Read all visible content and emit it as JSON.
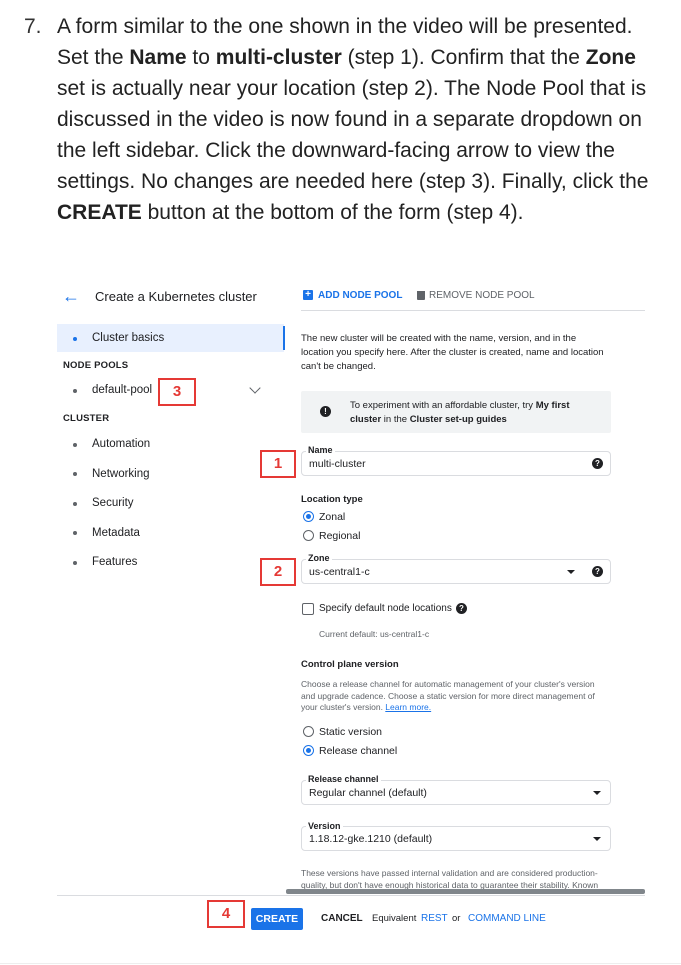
{
  "instruction": {
    "number": "7.",
    "parts": [
      {
        "text": "A form similar to the one shown in the video will be presented. Set the ",
        "bold": false
      },
      {
        "text": "Name",
        "bold": true
      },
      {
        "text": " to ",
        "bold": false
      },
      {
        "text": "multi-cluster",
        "bold": true
      },
      {
        "text": " (step 1). Confirm that the ",
        "bold": false
      },
      {
        "text": "Zone",
        "bold": true
      },
      {
        "text": " set is actually near your location (step 2). The Node Pool that is discussed in the video is now found in a separate dropdown on the left sidebar. Click the downward-facing arrow to view the settings. No changes are needed here (step 3). Finally, click the ",
        "bold": false
      },
      {
        "text": "CREATE",
        "bold": true
      },
      {
        "text": " button at the bottom of the form (step 4).",
        "bold": false
      }
    ]
  },
  "header": {
    "title": "Create a Kubernetes cluster",
    "add_node_pool": "ADD NODE POOL",
    "remove_node_pool": "REMOVE NODE POOL"
  },
  "sidebar": {
    "cluster_basics": "Cluster basics",
    "node_pools_heading": "NODE POOLS",
    "default_pool": "default-pool",
    "cluster_heading": "CLUSTER",
    "items": [
      "Automation",
      "Networking",
      "Security",
      "Metadata",
      "Features"
    ]
  },
  "callouts": {
    "step1": "1",
    "step2": "2",
    "step3": "3",
    "step4": "4"
  },
  "form": {
    "intro_line1": "The new cluster will be created with the name, version, and in the",
    "intro_line2": "location you specify here. After the cluster is created, name and location",
    "intro_line3": "can't be changed.",
    "info_line1_a": "To experiment with an affordable cluster, try ",
    "info_line1_b": "My first",
    "info_line2_a": "cluster",
    "info_line2_b": " in the ",
    "info_line2_c": "Cluster set-up guides",
    "name_label": "Name",
    "name_value": "multi-cluster",
    "location_type_label": "Location type",
    "zonal": "Zonal",
    "regional": "Regional",
    "zone_label": "Zone",
    "zone_value": "us-central1-c",
    "specify_default": "Specify default node locations",
    "current_default": "Current default: us-central1-c",
    "control_plane_label": "Control plane version",
    "cp_line1": "Choose a release channel for automatic management of your cluster's version",
    "cp_line2": "and upgrade cadence. Choose a static version for more direct management of",
    "cp_line3": "your cluster's version. ",
    "learn_more": "Learn more.",
    "static_version": "Static version",
    "release_channel": "Release channel",
    "release_channel_label": "Release channel",
    "release_channel_value": "Regular channel (default)",
    "version_label": "Version",
    "version_value": "1.18.12-gke.1210 (default)",
    "bottom_line1": "These versions have passed internal validation and are considered production-",
    "bottom_line2": "quality, but don't have enough historical data to guarantee their stability. Known"
  },
  "footer": {
    "create": "CREATE",
    "cancel": "CANCEL",
    "equivalent": "Equivalent",
    "rest": "REST",
    "or": "or",
    "command_line": "COMMAND LINE"
  },
  "colors": {
    "accent": "#1a73e8",
    "callout": "#e53935"
  }
}
